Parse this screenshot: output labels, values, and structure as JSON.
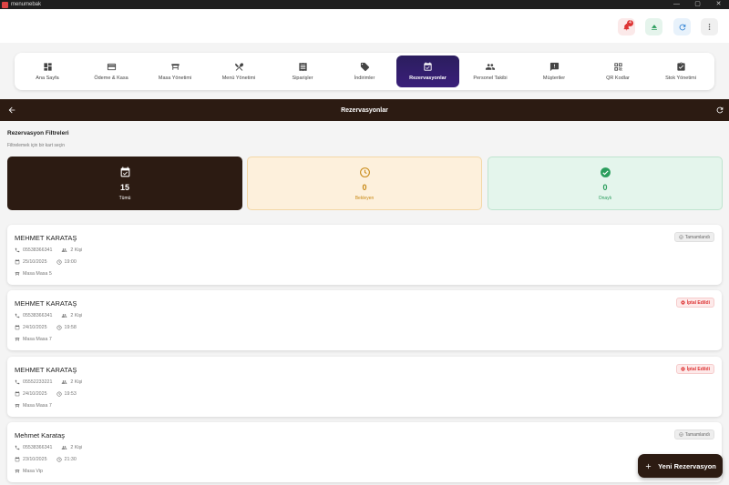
{
  "window": {
    "title": "menumebak",
    "minimize": "—",
    "maximize": "▢",
    "close": "✕"
  },
  "header": {
    "notification_count": "4"
  },
  "nav": {
    "items": [
      {
        "label": "Ana Sayfa",
        "icon": "dashboard-icon"
      },
      {
        "label": "Ödeme & Kasa",
        "icon": "credit-card-icon"
      },
      {
        "label": "Masa Yönetimi",
        "icon": "table-icon"
      },
      {
        "label": "Menü Yönetimi",
        "icon": "utensils-icon"
      },
      {
        "label": "Siparişler",
        "icon": "receipt-icon"
      },
      {
        "label": "İndirimler",
        "icon": "tag-icon"
      },
      {
        "label": "Rezervasyonlar",
        "icon": "calendar-check-icon",
        "active": true
      },
      {
        "label": "Personel Takibi",
        "icon": "people-icon"
      },
      {
        "label": "Müşteriler",
        "icon": "feedback-icon"
      },
      {
        "label": "QR Kodlar",
        "icon": "qr-code-icon"
      },
      {
        "label": "Stok Yönetimi",
        "icon": "clipboard-check-icon"
      }
    ]
  },
  "page": {
    "title": "Rezervasyonlar"
  },
  "filters": {
    "title": "Rezervasyon Filtreleri",
    "subtitle": "Filtrelemek için bir kart seçin",
    "cards": [
      {
        "count": "15",
        "label": "Tümü"
      },
      {
        "count": "0",
        "label": "Bekleyen"
      },
      {
        "count": "0",
        "label": "Onaylı"
      }
    ]
  },
  "reservations": [
    {
      "name": "MEHMET KARATAŞ",
      "phone": "05538366341",
      "people": "2 Kişi",
      "date": "25/10/2025",
      "time": "19:00",
      "table": "Masa Masa 5",
      "status": "Tamamlandı"
    },
    {
      "name": "MEHMET KARATAŞ",
      "phone": "05538366341",
      "people": "2 Kişi",
      "date": "24/10/2025",
      "time": "19:58",
      "table": "Masa Masa 7",
      "status": "İptal Edildi"
    },
    {
      "name": "MEHMET KARATAŞ",
      "phone": "05552233221",
      "people": "2 Kişi",
      "date": "24/10/2025",
      "time": "19:53",
      "table": "Masa Masa 7",
      "status": "İptal Edildi"
    },
    {
      "name": "Mehmet Karataş",
      "phone": "05538366341",
      "people": "2 Kişi",
      "date": "23/10/2025",
      "time": "21:30",
      "table": "Masa Vip",
      "status": "Tamamlandı"
    }
  ],
  "fab": {
    "label": "Yeni Rezervasyon"
  },
  "colors": {
    "primary": "#2c1b12",
    "active_nav": "#2b1d5e",
    "pending": "#c98a17",
    "approved": "#2a9d5c",
    "cancelled": "#d33333"
  }
}
